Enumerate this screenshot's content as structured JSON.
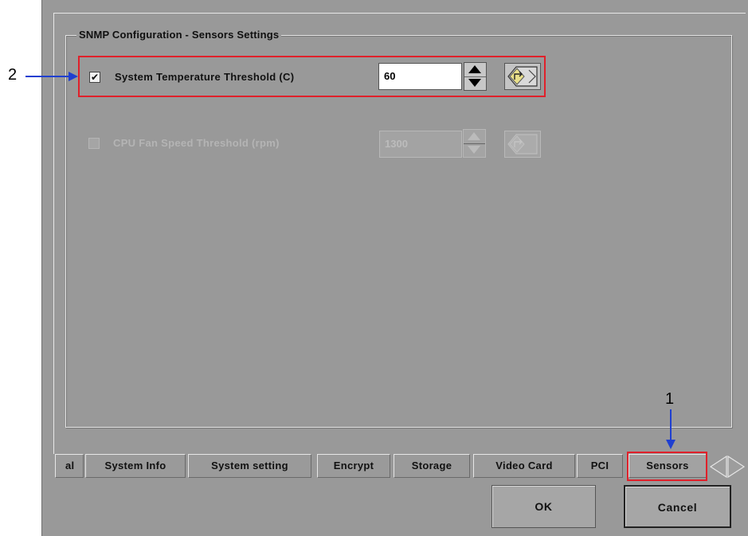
{
  "dialog": {
    "group_title": "SNMP Configuration - Sensors Settings"
  },
  "sensors": [
    {
      "label": "System Temperature Threshold (C)",
      "checked": true,
      "enabled": true,
      "value": "60"
    },
    {
      "label": "CPU Fan Speed Threshold (rpm)",
      "checked": false,
      "enabled": false,
      "value": "1300"
    }
  ],
  "tabs": [
    {
      "label": "al",
      "active": false
    },
    {
      "label": "System Info",
      "active": false
    },
    {
      "label": "System setting",
      "active": false
    },
    {
      "label": "Encrypt",
      "active": false
    },
    {
      "label": "Storage",
      "active": false
    },
    {
      "label": "Video Card",
      "active": false
    },
    {
      "label": "PCI",
      "active": false
    },
    {
      "label": "Sensors",
      "active": true
    }
  ],
  "buttons": {
    "ok": "OK",
    "cancel": "Cancel"
  },
  "callouts": {
    "one": "1",
    "two": "2"
  },
  "colors": {
    "panel_bg": "#999999",
    "highlight_red": "#e0202a",
    "callout_blue": "#1f3fd0"
  },
  "icons": {
    "checkbox_checked": "check-mark",
    "spin_up": "triangle-up",
    "spin_down": "triangle-down",
    "keyboard": "keyboard-icon",
    "tab_scroll": "tab-scroll-arrows-icon"
  }
}
